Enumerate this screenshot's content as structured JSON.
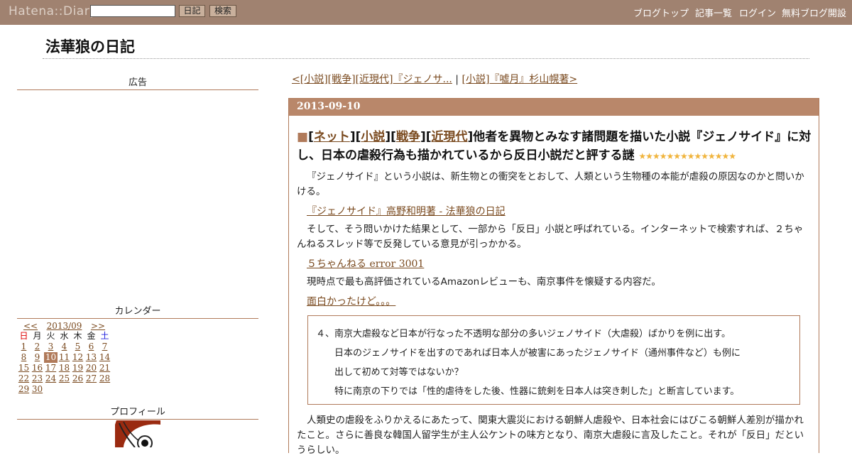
{
  "topbar": {
    "logo": "Hatena::Diary",
    "search_placeholder": "",
    "diary_button": "日記",
    "search_button": "検索",
    "nav": [
      "ブログトップ",
      "記事一覧",
      "ログイン",
      "無料ブログ開設"
    ]
  },
  "blog": {
    "title": "法華狼の日記"
  },
  "sidebar": {
    "ad_heading": "広告",
    "calendar_heading": "カレンダー",
    "calendar": {
      "prev": "<<",
      "month": "2013/09",
      "next": ">>",
      "weekdays": [
        "日",
        "月",
        "火",
        "水",
        "木",
        "金",
        "土"
      ],
      "today": "10",
      "weeks": [
        [
          "1",
          "2",
          "3",
          "4",
          "5",
          "6",
          "7"
        ],
        [
          "8",
          "9",
          "10",
          "11",
          "12",
          "13",
          "14"
        ],
        [
          "15",
          "16",
          "17",
          "18",
          "19",
          "20",
          "21"
        ],
        [
          "22",
          "23",
          "24",
          "25",
          "26",
          "27",
          "28"
        ],
        [
          "29",
          "30",
          "",
          "",
          "",
          "",
          ""
        ]
      ]
    },
    "profile_heading": "プロフィール"
  },
  "pager": {
    "prev": "<[小説][戦争][近現代]『ジェノサ...",
    "separator": " | ",
    "next": "[小説]『嘘月』杉山幌著>"
  },
  "post": {
    "date": "2013-09-10",
    "marker": "■",
    "tags": [
      "ネット",
      "小説",
      "戦争",
      "近現代"
    ],
    "title": "他者を異物とみなす諸問題を描いた小説『ジェノサイド』に対し、日本の虐殺行為も描かれているから反日小説だと評する謎",
    "stars": "★★★★★★★★★★★★★★",
    "p1": "『ジェノサイド』という小説は、新生物との衝突をとおして、人類という生物種の本能が虐殺の原因なのかと問いかける。",
    "link1": "『ジェノサイド』高野和明著 - 法華狼の日記",
    "p2": "そして、そう問いかけた結果として、一部から「反日」小説と呼ばれている。インターネットで検索すれば、２ちゃんねるスレッド等で反発している意見が引っかかる。",
    "link2": "５ちゃんねる error 3001",
    "p3": "現時点で最も高評価されているAmazonレビューも、南京事件を懐疑する内容だ。",
    "link3": "面白かったけど。。。",
    "quote": [
      "４、南京大虐殺など日本が行なった不透明な部分の多いジェノサイド（大虐殺）ばかりを例に出す。",
      "日本のジェノサイドを出すのであれば日本人が被害にあったジェノサイド（通州事件など）も例に",
      "出して初めて対等ではないか？",
      "特に南京の下りでは「性的虐待をした後、性器に銃剣を日本人は突き刺した」と断言しています。"
    ],
    "p4": "人類史の虐殺をふりかえるにあたって、関東大震災における朝鮮人虐殺や、日本社会にはびこる朝鮮人差別が描かれたこと。さらに善良な韓国人留学生が主人公ケントの味方となり、南京大虐殺に言及したこと。それが「反日」だというらしい。"
  },
  "colors": {
    "topbar": "#a08270",
    "accent": "#b07a5a",
    "link": "#7a4a1f"
  }
}
